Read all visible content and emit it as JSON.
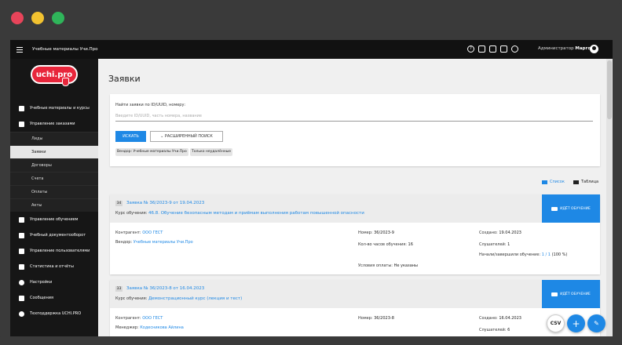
{
  "topbar": {
    "app_title": "Учебные материалы Учи.Про",
    "admin_label": "Администратор",
    "admin_name": "Марго"
  },
  "logo": {
    "text": "uchi.pro"
  },
  "sidebar": {
    "items": [
      {
        "label": "Учебные материалы и курсы",
        "icon": "library-icon"
      },
      {
        "label": "Управление заказами",
        "icon": "orders-icon"
      }
    ],
    "subitems": [
      {
        "label": "Лиды"
      },
      {
        "label": "Заявки"
      },
      {
        "label": "Договоры"
      },
      {
        "label": "Счета"
      },
      {
        "label": "Оплаты"
      },
      {
        "label": "Акты"
      }
    ],
    "items2": [
      {
        "label": "Управление обучением",
        "icon": "training-icon"
      },
      {
        "label": "Учебный документооборот",
        "icon": "document-icon"
      },
      {
        "label": "Управление пользователями",
        "icon": "users-icon"
      },
      {
        "label": "Статистика и отчёты",
        "icon": "stats-icon"
      },
      {
        "label": "Настройки",
        "icon": "gear-icon"
      },
      {
        "label": "Сообщения",
        "icon": "messages-icon"
      },
      {
        "label": "Техподдержка UCHI.PRO",
        "icon": "support-icon"
      }
    ]
  },
  "main": {
    "title": "Заявки",
    "search_label": "Найти заявки по ID/UUID, номеру:",
    "search_placeholder": "Введите ID/UUID, часть номера, название",
    "search_button": "ИСКАТЬ",
    "advanced_button": "РАСШИРЕННЫЙ ПОИСК",
    "chip_vendor": "Вендор: Учебные материалы Учи.Про",
    "chip_unlinked": "Только неудалённые",
    "view_list": "Список",
    "view_table": "Таблица"
  },
  "orders": [
    {
      "num": "34",
      "title": "Заявка № 36/2023-9 от 19.04.2023",
      "course_label": "Курс обучения:",
      "course": "46.8. Обучение безопасным методам и приёмам выполнения работам повышенной опасности",
      "status": "ИДЁТ ОБУЧЕНИЕ",
      "contractor_label": "Контрагент:",
      "contractor": "ООО ГЕСТ",
      "vendor_label": "Вендор:",
      "vendor": "Учебные материалы Учи.Про",
      "number_label": "Номер:",
      "number": "36/2023-9",
      "hours_label": "Кол-во часов обучения:",
      "hours": "16",
      "payment_label": "Условия оплаты:",
      "payment": "Не указаны",
      "created_label": "Создано:",
      "created": "19.04.2023",
      "listeners_label": "Слушателей:",
      "listeners": "1",
      "progress_label": "Начали/завершили обучение:",
      "progress_link": "1 / 1",
      "progress_pct": "(100 %)"
    },
    {
      "num": "33",
      "title": "Заявка № 36/2023-8 от 16.04.2023",
      "course_label": "Курс обучения:",
      "course": "Демонстрационный курс (лекция и тест)",
      "status": "ИДЁТ ОБУЧЕНИЕ",
      "contractor_label": "Контрагент:",
      "contractor": "ООО ГЕСТ",
      "manager_label": "Менеджер:",
      "manager": "Кодесникова Айлина",
      "number_label": "Номер:",
      "number": "36/2023-8",
      "created_label": "Создано:",
      "created": "16.04.2023",
      "listeners_label": "Слушателей:",
      "listeners": "6"
    }
  ],
  "fab": {
    "csv": "CSV",
    "plus": "+",
    "wand": "✎"
  },
  "colors": {
    "accent": "#1e88e5",
    "brand": "#e8263b",
    "sidebar": "#161616"
  }
}
